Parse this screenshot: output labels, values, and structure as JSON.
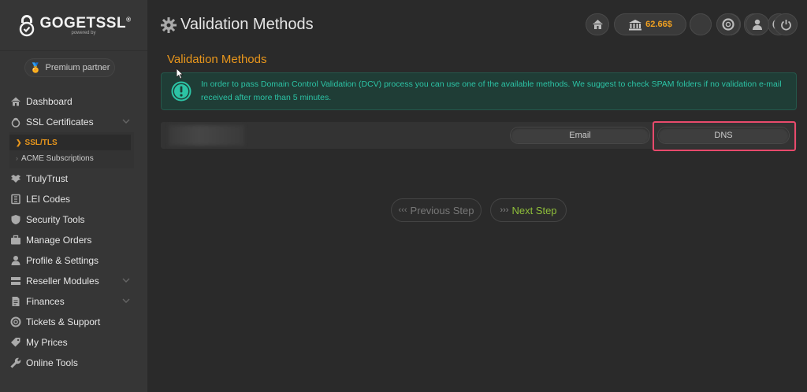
{
  "brand": {
    "name": "GOGETSSL",
    "reg": "®",
    "sub": "powered by"
  },
  "partner": {
    "label": "Premium partner"
  },
  "sidebar": {
    "items": [
      {
        "label": "Dashboard",
        "icon": "home-icon"
      },
      {
        "label": "SSL Certificates",
        "icon": "lock-icon",
        "expanded": true
      },
      {
        "label": "TrulyTrust",
        "icon": "wings-icon"
      },
      {
        "label": "LEI Codes",
        "icon": "building-icon"
      },
      {
        "label": "Security Tools",
        "icon": "shield-icon"
      },
      {
        "label": "Manage Orders",
        "icon": "briefcase-icon"
      },
      {
        "label": "Profile & Settings",
        "icon": "user-icon"
      },
      {
        "label": "Reseller Modules",
        "icon": "modules-icon"
      },
      {
        "label": "Finances",
        "icon": "document-icon"
      },
      {
        "label": "Tickets & Support",
        "icon": "lifebuoy-icon"
      },
      {
        "label": "My Prices",
        "icon": "tags-icon"
      },
      {
        "label": "Online Tools",
        "icon": "wrench-icon"
      }
    ],
    "ssl_sub": [
      {
        "label": "SSL/TLS",
        "active": true
      },
      {
        "label": "ACME Subscriptions",
        "active": false
      }
    ]
  },
  "header": {
    "title": "Validation Methods",
    "balance": "62.66$"
  },
  "main": {
    "section_title": "Validation Methods",
    "alert_text": "In order to pass Domain Control Validation (DCV) process you can use one of the available methods. We suggest to check SPAM folders if no validation e-mail received after more than 5 minutes.",
    "methods": [
      "Email",
      "DNS"
    ],
    "prev_label": "Previous Step",
    "next_label": "Next Step"
  },
  "colors": {
    "accent": "#e8961c",
    "alert_text": "#2cc3a5",
    "next": "#8fbf3a",
    "highlight": "#e84a6c"
  }
}
